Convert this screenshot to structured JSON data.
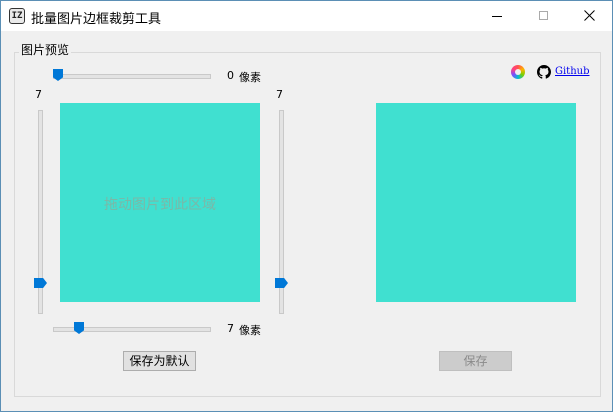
{
  "window": {
    "title": "批量图片边框裁剪工具",
    "app_icon_text": "IZ"
  },
  "group": {
    "title": "图片预览"
  },
  "sliders": {
    "top": {
      "value": "0",
      "unit": "像素",
      "position_fraction": 0.0
    },
    "bottom": {
      "value": "7",
      "unit": "像素",
      "position_fraction": 0.15
    },
    "left": {
      "value": "7",
      "position_fraction": 0.85
    },
    "right": {
      "value": "7",
      "position_fraction": 0.85
    }
  },
  "preview": {
    "drop_hint": "拖动图片到此区域",
    "color": "#40e0d0"
  },
  "buttons": {
    "save_default": "保存为默认",
    "save": "保存"
  },
  "links": {
    "github": "Github",
    "color_icon": "color-wheel-icon",
    "github_icon": "github-icon"
  },
  "colors": {
    "accent": "#0078d7",
    "preview": "#40e0d0"
  }
}
